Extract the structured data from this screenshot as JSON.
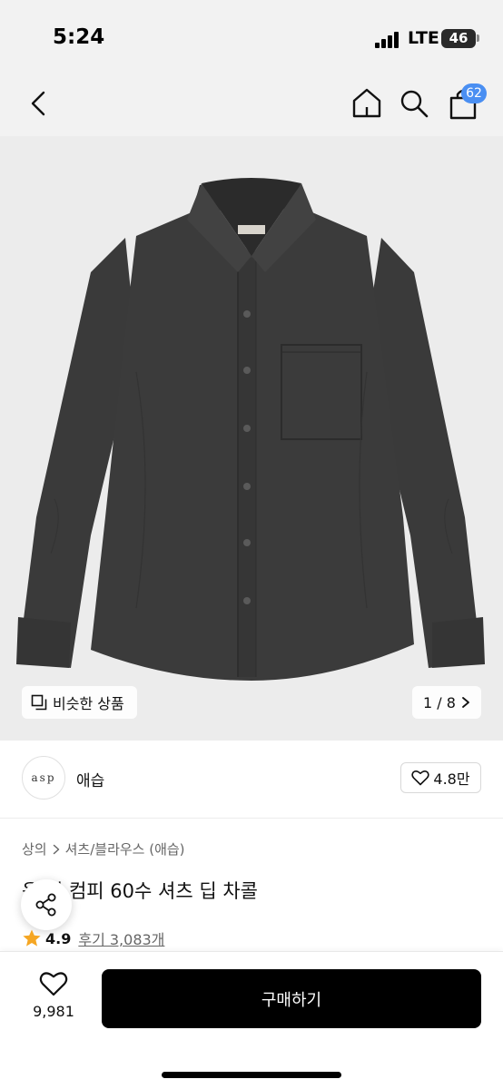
{
  "status_bar": {
    "time": "5:24",
    "network": "LTE",
    "battery": "46"
  },
  "nav": {
    "back_icon": "chevron-left-icon",
    "home_icon": "home-icon",
    "search_icon": "search-icon",
    "cart_icon": "shopping-bag-icon",
    "cart_count": "62"
  },
  "product_image": {
    "similar_label": "비슷한 상품",
    "page_indicator": "1 / 8"
  },
  "brand": {
    "logo_text": "asp",
    "name": "애습",
    "likes": "4.8만"
  },
  "breadcrumb": {
    "category": "상의",
    "subcategory": "셔츠/블라우스 (애습)"
  },
  "product": {
    "title": "옥스포드 컴피 60수 셔츠 딥 차콜",
    "title_visible": "옥 이 컴피 60수 셔츠 딥 차콜",
    "rating": "4.9",
    "reviews": "후기 3,083개"
  },
  "bottom_bar": {
    "wish_count": "9,981",
    "buy_label": "구매하기"
  },
  "colors": {
    "accent": "#4a8ff2",
    "star": "#f5a623",
    "buy_button": "#000000",
    "shirt": "#3b3b3b"
  }
}
